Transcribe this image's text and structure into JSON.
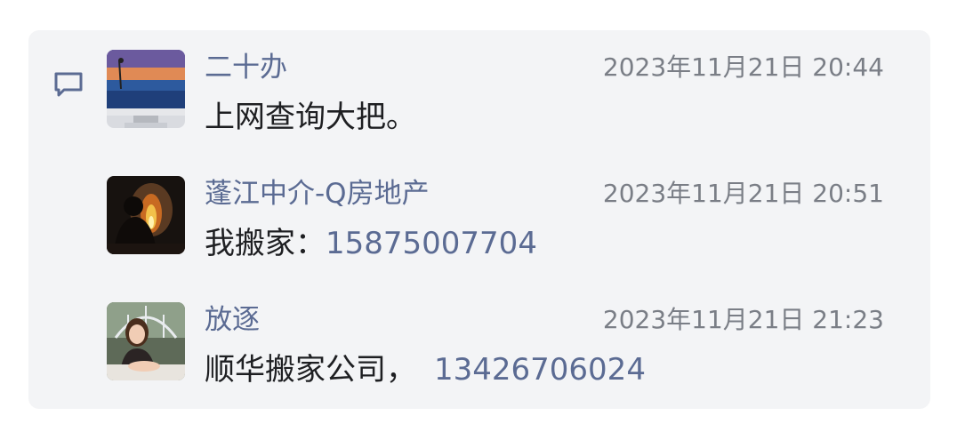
{
  "comments": [
    {
      "name": "二十办",
      "time": "2023年11月21日 20:44",
      "text": "上网查询大把。",
      "phone": ""
    },
    {
      "name": "蓬江中介-Q房地产",
      "time": "2023年11月21日 20:51",
      "text": "我搬家：",
      "phone": "15875007704"
    },
    {
      "name": "放逐",
      "time": "2023年11月21日 21:23",
      "text": "顺华搬家公司，",
      "phone": "13426706024"
    }
  ],
  "icons": {
    "comment": "comment-icon"
  },
  "colors": {
    "name": "#5b6b93",
    "phone": "#5b6b93",
    "time": "#7a7e86",
    "text": "#1e1f22",
    "panel": "#f3f4f6"
  }
}
